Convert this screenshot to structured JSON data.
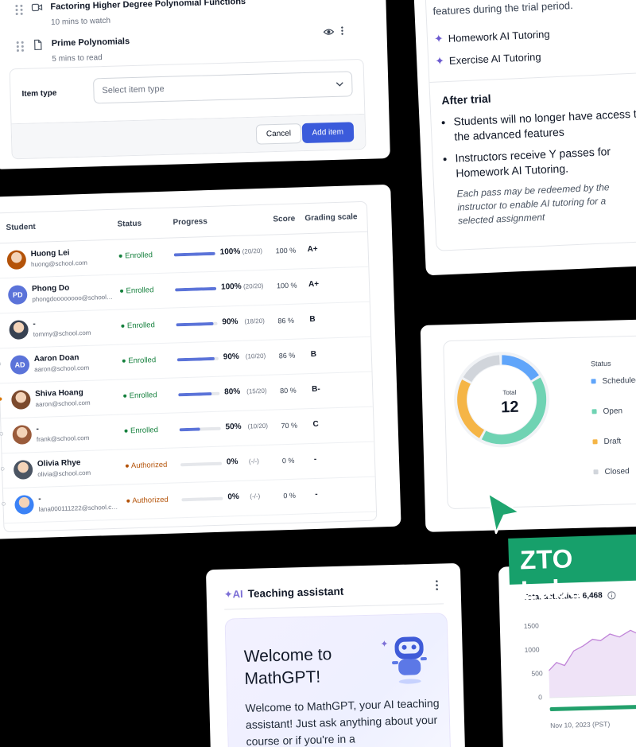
{
  "course_items": {
    "items": [
      {
        "title": "Factoring Higher Degree Polynomial Functions",
        "meta": "10 mins to watch",
        "icon": "video-icon"
      },
      {
        "title": "Prime Polynomials",
        "meta": "5 mins to read",
        "icon": "document-icon"
      }
    ],
    "item_type_label": "Item type",
    "select_placeholder": "Select item type",
    "cancel_label": "Cancel",
    "add_label": "Add item"
  },
  "trial": {
    "intro": "features during the trial period.",
    "features": [
      "Homework AI Tutoring",
      "Exercise AI Tutoring"
    ],
    "after_heading": "After trial",
    "bullets": [
      "Students will no longer have access to the advanced features",
      "Instructors receive Y passes for Homework AI Tutoring."
    ],
    "note": "Each pass may be redeemed by the instructor to enable AI tutoring for a selected assignment"
  },
  "gradebook": {
    "columns": [
      "Student",
      "Status",
      "Progress",
      "Score",
      "Grading scale"
    ],
    "rows": [
      {
        "name": "Huong Lei",
        "email": "huong@school.com",
        "status": "Enrolled",
        "progress": 1.0,
        "pct": "100%",
        "frac": "(20/20)",
        "score": "100 %",
        "grade": "A+",
        "medal": "gold",
        "avatar": "photo",
        "avatar_color": "#b45309"
      },
      {
        "name": "Phong Do",
        "email": "phongdoooooooo@school.com",
        "status": "Enrolled",
        "progress": 1.0,
        "pct": "100%",
        "frac": "(20/20)",
        "score": "100 %",
        "grade": "A+",
        "medal": "gold",
        "avatar": "PD",
        "avatar_color": "#5b73d9"
      },
      {
        "name": "-",
        "email": "tommy@school.com",
        "status": "Enrolled",
        "progress": 0.9,
        "pct": "90%",
        "frac": "(18/20)",
        "score": "86 %",
        "grade": "B",
        "medal": "none",
        "avatar": "photo",
        "avatar_color": "#374151"
      },
      {
        "name": "Aaron Doan",
        "email": "aaron@school.com",
        "status": "Enrolled",
        "progress": 0.9,
        "pct": "90%",
        "frac": "(10/20)",
        "score": "86 %",
        "grade": "B",
        "medal": "none",
        "avatar": "AD",
        "avatar_color": "#5b73d9"
      },
      {
        "name": "Shiva Hoang",
        "email": "aaron@school.com",
        "status": "Enrolled",
        "progress": 0.8,
        "pct": "80%",
        "frac": "(15/20)",
        "score": "80 %",
        "grade": "B-",
        "medal": "gold",
        "avatar": "photo",
        "avatar_color": "#7c4a2d"
      },
      {
        "name": "-",
        "email": "frank@school.com",
        "status": "Enrolled",
        "progress": 0.5,
        "pct": "50%",
        "frac": "(10/20)",
        "score": "70 %",
        "grade": "C",
        "medal": "none",
        "avatar": "photo",
        "avatar_color": "#9a5b3b"
      },
      {
        "name": "Olivia Rhye",
        "email": "olivia@school.com",
        "status": "Authorized",
        "progress": 0,
        "pct": "0%",
        "frac": "(-/-)",
        "score": "0 %",
        "grade": "-",
        "medal": "none",
        "avatar": "photo",
        "avatar_color": "#4b5563"
      },
      {
        "name": "-",
        "email": "lana000111222@school.com",
        "status": "Authorized",
        "progress": 0,
        "pct": "0%",
        "frac": "(-/-)",
        "score": "0 %",
        "grade": "-",
        "medal": "none",
        "avatar": "photo",
        "avatar_color": "#3b82f6"
      }
    ]
  },
  "donut": {
    "total_label": "Total",
    "total": "12",
    "status_heading": "Status",
    "segments": [
      {
        "label": "Scheduled",
        "value": 2,
        "color": "#60a5fa"
      },
      {
        "label": "Open",
        "value": 5,
        "color": "#6fd3b3"
      },
      {
        "label": "Draft",
        "value": 3,
        "color": "#f5b546"
      },
      {
        "label": "Closed",
        "value": 2,
        "color": "#d1d5db"
      }
    ]
  },
  "assistant": {
    "title": "Teaching assistant",
    "heading": "Welcome to MathGPT!",
    "body": "Welcome to MathGPT, your AI teaching assistant! Just ask anything about your course or if you're in a"
  },
  "activities": {
    "title": "Total activities: 6,468",
    "y_ticks": [
      "1500",
      "1000",
      "500",
      "0"
    ],
    "x_label": "Nov 10, 2023 (PST)"
  },
  "badge": {
    "text": "ZTO Labs"
  }
}
